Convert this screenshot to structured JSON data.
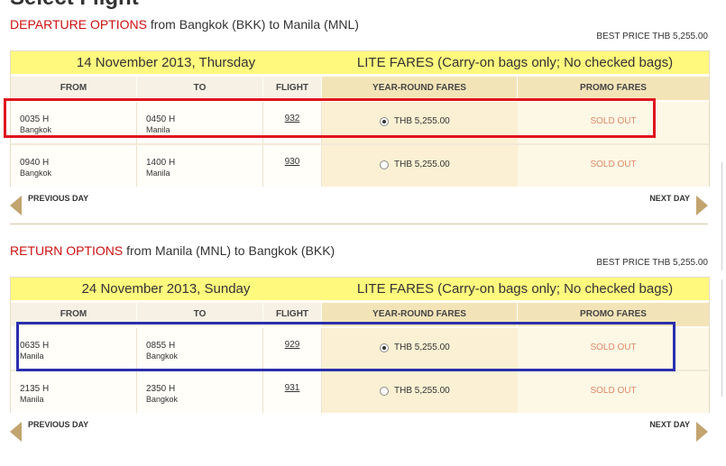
{
  "page_title": "Select Flight",
  "departure": {
    "title_label": "DEPARTURE OPTIONS",
    "title_route": "from Bangkok (BKK) to Manila (MNL)",
    "best_price": "BEST PRICE THB  5,255.00",
    "date": "14 November 2013, Thursday",
    "fare_title": "LITE FARES (Carry-on bags only; No checked bags)",
    "columns": {
      "from": "FROM",
      "to": "TO",
      "flight": "FLIGHT",
      "year_round": "YEAR-ROUND FARES",
      "promo": "PROMO FARES"
    },
    "rows": [
      {
        "dep_time": "0035 H",
        "dep_city": "Bangkok",
        "arr_time": "0450 H",
        "arr_city": "Manila",
        "flight": "932",
        "fare": "THB  5,255.00",
        "selected": true,
        "promo": "SOLD OUT"
      },
      {
        "dep_time": "0940 H",
        "dep_city": "Bangkok",
        "arr_time": "1400 H",
        "arr_city": "Manila",
        "flight": "930",
        "fare": "THB  5,255.00",
        "selected": false,
        "promo": "SOLD OUT"
      }
    ],
    "prev_day": "PREVIOUS DAY",
    "next_day": "NEXT DAY"
  },
  "return": {
    "title_label": "RETURN OPTIONS",
    "title_route": "from Manila (MNL) to Bangkok (BKK)",
    "best_price": "BEST PRICE THB  5,255.00",
    "date": "24 November 2013, Sunday",
    "fare_title": "LITE FARES (Carry-on bags only; No checked bags)",
    "columns": {
      "from": "FROM",
      "to": "TO",
      "flight": "FLIGHT",
      "year_round": "YEAR-ROUND FARES",
      "promo": "PROMO FARES"
    },
    "rows": [
      {
        "dep_time": "0635 H",
        "dep_city": "Manila",
        "arr_time": "0855 H",
        "arr_city": "Bangkok",
        "flight": "929",
        "fare": "THB  5,255.00",
        "selected": true,
        "promo": "SOLD OUT"
      },
      {
        "dep_time": "2135 H",
        "dep_city": "Manila",
        "arr_time": "2350 H",
        "arr_city": "Bangkok",
        "flight": "931",
        "fare": "THB  5,255.00",
        "selected": false,
        "promo": "SOLD OUT"
      }
    ],
    "prev_day": "PREVIOUS DAY",
    "next_day": "NEXT DAY"
  },
  "colors": {
    "section_label": "#cc1111",
    "header_bar": "#fff97e",
    "fare_column": "#fbf0d3",
    "sold_out": "#e08a66",
    "highlight_departure": "#e0141e",
    "highlight_return": "#2b2fae",
    "nav_arrow": "#c2a46f"
  },
  "icons": {
    "prev": "arrow-left-icon",
    "next": "arrow-right-icon"
  }
}
